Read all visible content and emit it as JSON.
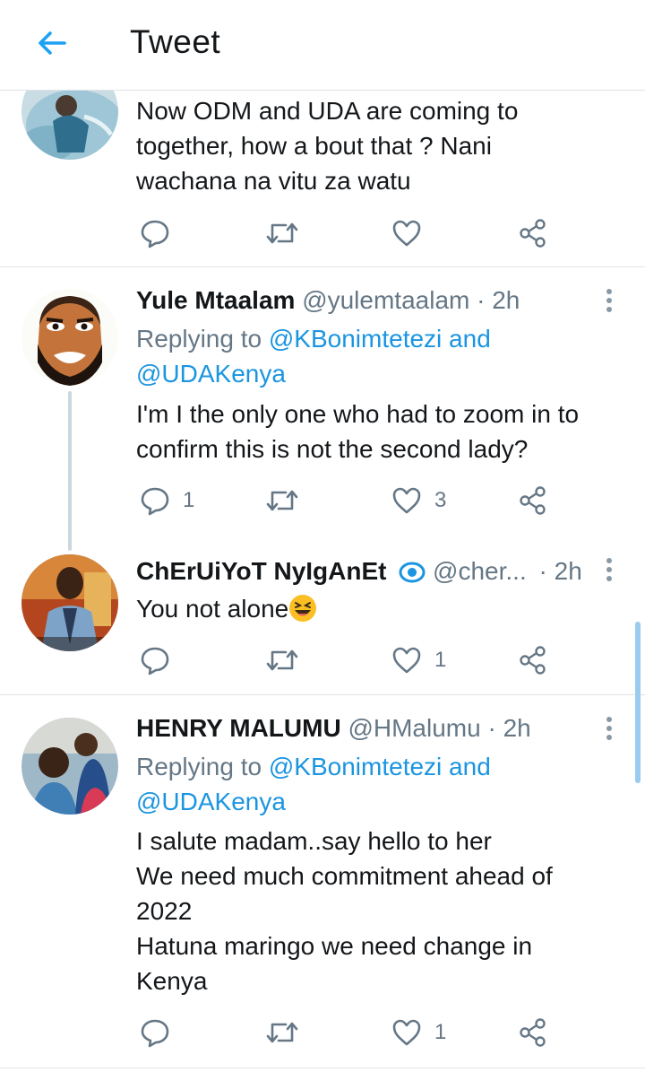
{
  "header": {
    "title": "Tweet"
  },
  "tweets": [
    {
      "text_lines": [
        "Now ODM and UDA are coming to",
        "together, how  a bout that ? Nani",
        "wachana na vitu za watu"
      ],
      "reply_count": "",
      "retweet_count": "",
      "like_count": ""
    },
    {
      "name": "Yule Mtaalam",
      "handle": "@yulemtaalam",
      "dot": "·",
      "time": "2h",
      "replying_prefix": "Replying to ",
      "mention1": "@KBonimtetezi",
      "and": " and",
      "mention2": "@UDAKenya",
      "text_lines": [
        "I'm I the only one who had to zoom in to",
        "confirm this is not the second lady?"
      ],
      "reply_count": "1",
      "retweet_count": "",
      "like_count": "3"
    },
    {
      "name": "ChErUiYoT NyIgAnEt",
      "handle": "@cher...",
      "dot": "·",
      "time": "2h",
      "text": "You not alone",
      "reply_count": "",
      "retweet_count": "",
      "like_count": "1"
    },
    {
      "name": "HENRY MALUMU",
      "handle": "@HMalumu",
      "dot": "·",
      "time": "2h",
      "replying_prefix": "Replying to ",
      "mention1": "@KBonimtetezi",
      "and": " and",
      "mention2": "@UDAKenya",
      "text_lines": [
        "I salute madam..say hello to her",
        "We need much commitment ahead of",
        "2022",
        "Hatuna maringo we need change in",
        "Kenya"
      ],
      "reply_count": "",
      "retweet_count": "",
      "like_count": "1"
    }
  ],
  "colors": {
    "accent": "#1b95e0",
    "secondary": "#657786",
    "divider": "#dfe3e6"
  },
  "icons": [
    "back-arrow-icon",
    "reply-icon",
    "retweet-icon",
    "like-icon",
    "share-icon",
    "more-options-icon",
    "verified-badge-icon",
    "laughing-emoji-icon"
  ]
}
